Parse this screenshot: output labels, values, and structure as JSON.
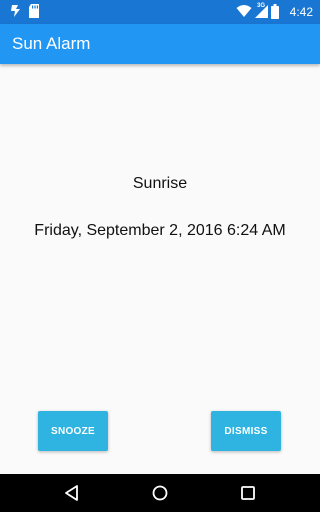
{
  "status_bar": {
    "time": "4:42",
    "network_label": "3G",
    "icons": [
      "app-notification-icon",
      "sd-card-icon",
      "wifi-icon",
      "cell-signal-icon",
      "battery-icon"
    ]
  },
  "app_bar": {
    "title": "Sun Alarm"
  },
  "alarm": {
    "event_label": "Sunrise",
    "date_time": "Friday, September 2, 2016 6:24 AM"
  },
  "actions": {
    "snooze_label": "SNOOZE",
    "dismiss_label": "DISMISS"
  },
  "nav_bar": {
    "icons": [
      "back-icon",
      "home-icon",
      "recents-icon"
    ]
  },
  "colors": {
    "status_bar": "#1976d2",
    "app_bar": "#2196f3",
    "button": "#2fb3e0",
    "background": "#fafafa",
    "nav_bar": "#000000"
  }
}
